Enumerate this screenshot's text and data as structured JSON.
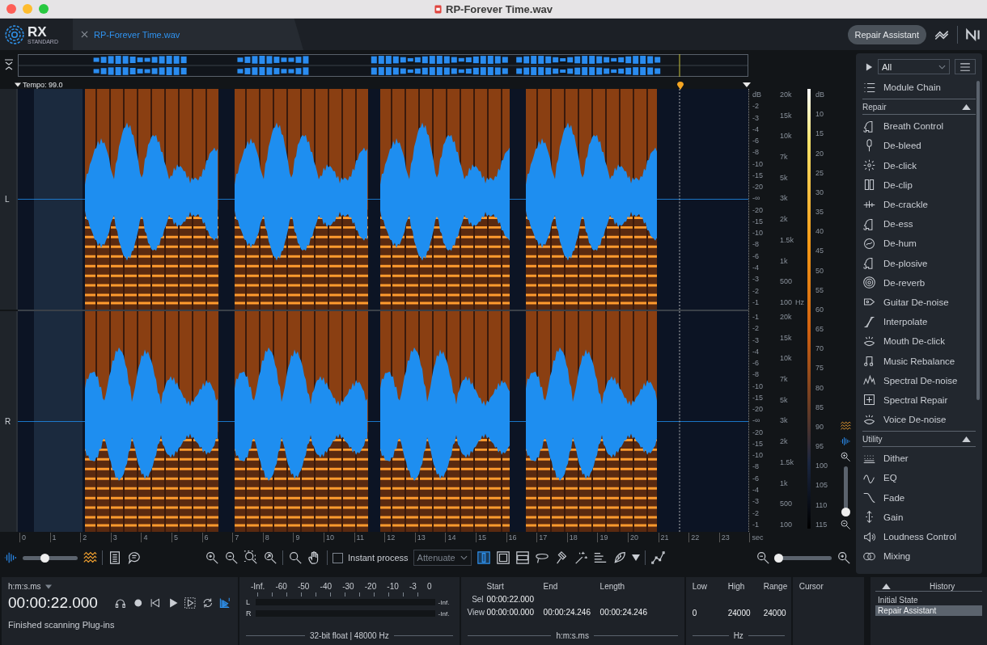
{
  "window": {
    "title": "RP-Forever Time.wav"
  },
  "app": {
    "logo": "RX",
    "edition": "STANDARD"
  },
  "tabs": [
    {
      "label": "RP-Forever Time.wav",
      "selected": true
    }
  ],
  "header": {
    "repair_assistant": "Repair Assistant"
  },
  "editor": {
    "tempo": "Tempo: 99.0",
    "channels": [
      {
        "label": "L",
        "amplitude_scale": [
          "dB",
          "-2",
          "-3",
          "-4",
          "-6",
          "-8",
          "-10",
          "-15",
          "-20",
          "-∞",
          "-20",
          "-15",
          "-10",
          "-8",
          "-6",
          "-4",
          "-3",
          "-2",
          "-1"
        ],
        "frequency_scale": [
          "20k",
          "15k",
          "10k",
          "7k",
          "5k",
          "3k",
          "2k",
          "1.5k",
          "1k",
          "500",
          "100"
        ]
      },
      {
        "label": "R",
        "amplitude_scale": [
          "-1",
          "-2",
          "-3",
          "-4",
          "-6",
          "-8",
          "-10",
          "-15",
          "-20",
          "-∞",
          "-20",
          "-15",
          "-10",
          "-8",
          "-6",
          "-4",
          "-3",
          "-2",
          "-1"
        ],
        "frequency_scale": [
          "20k",
          "15k",
          "10k",
          "7k",
          "5k",
          "3k",
          "2k",
          "1.5k",
          "1k",
          "500",
          "100"
        ]
      }
    ],
    "frequency_unit": "Hz",
    "color_scale": [
      "dB",
      "10",
      "15",
      "20",
      "25",
      "30",
      "35",
      "40",
      "45",
      "50",
      "55",
      "60",
      "65",
      "70",
      "75",
      "80",
      "85",
      "90",
      "95",
      "100",
      "105",
      "110",
      "115"
    ],
    "time_axis": [
      "0",
      "1",
      "2",
      "3",
      "4",
      "5",
      "6",
      "7",
      "8",
      "9",
      "10",
      "11",
      "12",
      "13",
      "14",
      "15",
      "16",
      "17",
      "18",
      "19",
      "20",
      "21",
      "22",
      "23",
      "sec"
    ],
    "vertical_zoom": {
      "level": 0.05
    }
  },
  "toolbar": {
    "opacity": {
      "level": 0.4
    },
    "instant_process": {
      "label": "Instant process",
      "checked": false
    },
    "mode": "Attenuate",
    "selection_tools": [
      {
        "selected": true
      },
      {
        "selected": false
      },
      {
        "selected": false
      },
      {
        "selected": false
      },
      {
        "selected": false
      },
      {
        "selected": false
      },
      {
        "selected": false
      },
      {
        "selected": false
      }
    ],
    "zoom": {
      "level": 0.05
    }
  },
  "modules": {
    "filter": "All",
    "module_chain": "Module Chain",
    "sections": [
      {
        "title": "Repair",
        "expanded": true,
        "items": [
          "Breath Control",
          "De-bleed",
          "De-click",
          "De-clip",
          "De-crackle",
          "De-ess",
          "De-hum",
          "De-plosive",
          "De-reverb",
          "Guitar De-noise",
          "Interpolate",
          "Mouth De-click",
          "Music Rebalance",
          "Spectral De-noise",
          "Spectral Repair",
          "Voice De-noise"
        ]
      },
      {
        "title": "Utility",
        "expanded": true,
        "items": [
          "Dither",
          "EQ",
          "Fade",
          "Gain",
          "Loudness Control",
          "Mixing"
        ]
      }
    ]
  },
  "transport": {
    "time_format": "h:m:s.ms",
    "time": "00:00:22.000",
    "status": "Finished scanning Plug-ins",
    "buttons": [
      {
        "kind": "monitor",
        "on": false
      },
      {
        "kind": "record",
        "on": false
      },
      {
        "kind": "rewind",
        "on": false
      },
      {
        "kind": "play",
        "on": false
      },
      {
        "kind": "play_selection",
        "on": false
      },
      {
        "kind": "loop",
        "on": false
      },
      {
        "kind": "follow",
        "on": true
      }
    ]
  },
  "meter": {
    "scale": [
      "-Inf.",
      "-60",
      "-50",
      "-40",
      "-30",
      "-20",
      "-10",
      "-3",
      "0"
    ],
    "channels": [
      {
        "label": "L",
        "reading": "-Inf."
      },
      {
        "label": "R",
        "reading": "-Inf."
      }
    ],
    "format": "32-bit float | 48000 Hz"
  },
  "selection": {
    "columns": [
      "Start",
      "End",
      "Length"
    ],
    "rows": [
      {
        "label": "Sel",
        "cells": [
          "00:00:22.000"
        ]
      },
      {
        "label": "View",
        "cells": [
          "00:00:00.000",
          "00:00:24.246",
          "00:00:24.246"
        ]
      }
    ],
    "unit": "h:m:s.ms"
  },
  "frequency": {
    "columns": [
      "Low",
      "High",
      "Range"
    ],
    "values": [
      "0",
      "24000",
      "24000"
    ],
    "unit": "Hz"
  },
  "cursor": {
    "title": "Cursor"
  },
  "history": {
    "title": "History",
    "items": [
      {
        "label": "Initial State",
        "selected": false
      },
      {
        "label": "Repair Assistant",
        "selected": true
      }
    ]
  }
}
